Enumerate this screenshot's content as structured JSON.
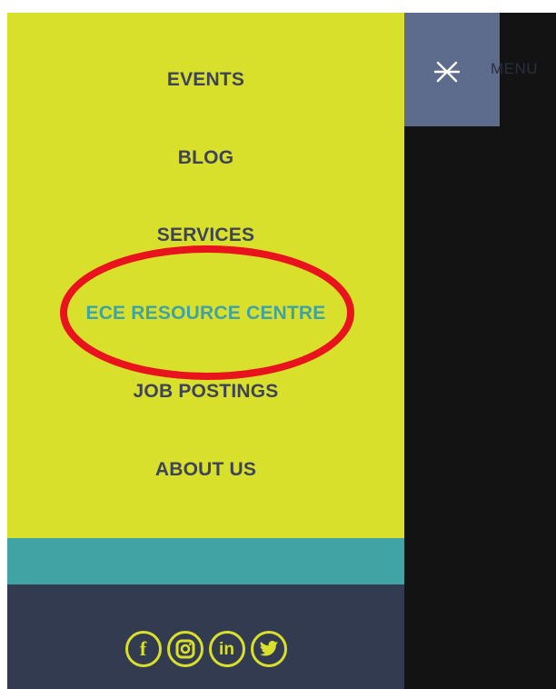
{
  "menu": {
    "items": [
      {
        "label": "EVENTS"
      },
      {
        "label": "BLOG"
      },
      {
        "label": "SERVICES"
      },
      {
        "label": "ECE RESOURCE CENTRE"
      },
      {
        "label": "JOB POSTINGS"
      },
      {
        "label": "ABOUT US"
      }
    ],
    "active_index": 3
  },
  "toggle": {
    "label": "MENU",
    "icon": "close-icon"
  },
  "social": [
    {
      "icon": "facebook-icon",
      "glyph": "f"
    },
    {
      "icon": "instagram-icon",
      "glyph": ""
    },
    {
      "icon": "linkedin-icon",
      "glyph": "in"
    },
    {
      "icon": "twitter-icon",
      "glyph": ""
    }
  ],
  "colors": {
    "menu_background": "#d9e02b",
    "menu_text": "#3e4457",
    "active_text": "#3ea3a4",
    "teal_band": "#40a3a4",
    "footer_background": "#333b50",
    "toggle_background": "#5d6b8c",
    "page_background": "#131313",
    "annotation": "#e8131c"
  }
}
